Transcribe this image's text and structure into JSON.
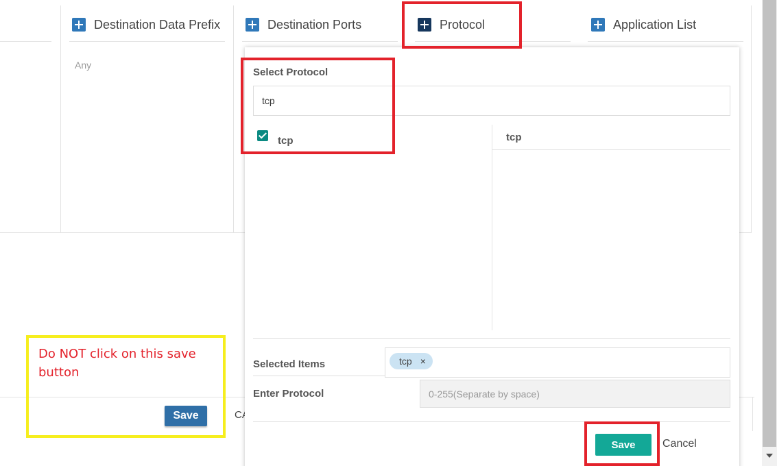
{
  "columns": [
    {
      "label": "Destination Data Prefix",
      "value": "Any"
    },
    {
      "label": "Destination Ports"
    },
    {
      "label": "Protocol"
    },
    {
      "label": "Application List"
    }
  ],
  "background": {
    "save_label": "Save",
    "cancel_label_partial": "CA"
  },
  "annotation": {
    "note": "Do NOT click on this save button"
  },
  "popup": {
    "title": "Select Protocol",
    "search_value": "tcp",
    "options": [
      {
        "label": "tcp",
        "checked": true
      }
    ],
    "right_header": "tcp",
    "selected_items_label": "Selected Items",
    "selected_chips": [
      "tcp"
    ],
    "chip_remove_glyph": "×",
    "enter_protocol_label": "Enter Protocol",
    "enter_protocol_placeholder": "0-255(Separate by space)",
    "save_label": "Save",
    "cancel_label": "Cancel"
  },
  "colors": {
    "plus_icon": "#2f78b9",
    "plus_icon_active": "#16375d",
    "popup_save": "#13a897",
    "highlight_red": "#e3222b",
    "highlight_yellow": "#f6ee1e"
  }
}
